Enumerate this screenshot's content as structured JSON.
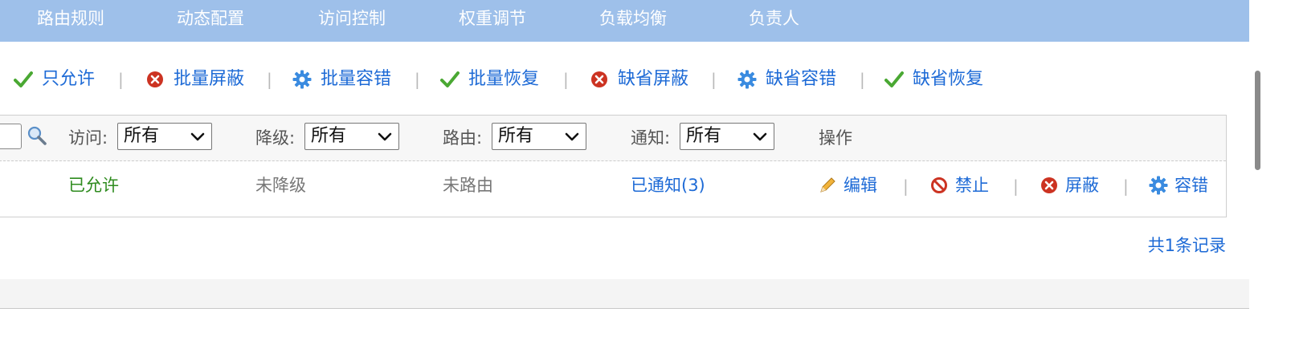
{
  "tabs": [
    "路由规则",
    "动态配置",
    "访问控制",
    "权重调节",
    "负载均衡",
    "负责人"
  ],
  "actions": [
    {
      "label": "只允许",
      "icon": "check-icon"
    },
    {
      "label": "批量屏蔽",
      "icon": "x-circle-icon"
    },
    {
      "label": "批量容错",
      "icon": "gear-icon"
    },
    {
      "label": "批量恢复",
      "icon": "check-icon"
    },
    {
      "label": "缺省屏蔽",
      "icon": "x-circle-icon"
    },
    {
      "label": "缺省容错",
      "icon": "gear-icon"
    },
    {
      "label": "缺省恢复",
      "icon": "check-icon"
    }
  ],
  "separator": "|",
  "filters": {
    "access": {
      "label": "访问:",
      "value": "所有"
    },
    "degrade": {
      "label": "降级:",
      "value": "所有"
    },
    "route": {
      "label": "路由:",
      "value": "所有"
    },
    "notify": {
      "label": "通知:",
      "value": "所有"
    },
    "operations_header": "操作"
  },
  "row": {
    "access": "已允许",
    "degrade": "未降级",
    "route": "未路由",
    "notify": "已通知(3)",
    "ops": [
      {
        "label": "编辑",
        "icon": "pencil-icon"
      },
      {
        "label": "禁止",
        "icon": "forbidden-icon"
      },
      {
        "label": "屏蔽",
        "icon": "x-circle-icon"
      },
      {
        "label": "容错",
        "icon": "gear-icon"
      }
    ]
  },
  "total_records": "共1条记录",
  "colors": {
    "accent": "#1d6ad6",
    "tabbar": "#9ec0ea",
    "allowed": "#2e8b1e",
    "muted": "#777777"
  }
}
